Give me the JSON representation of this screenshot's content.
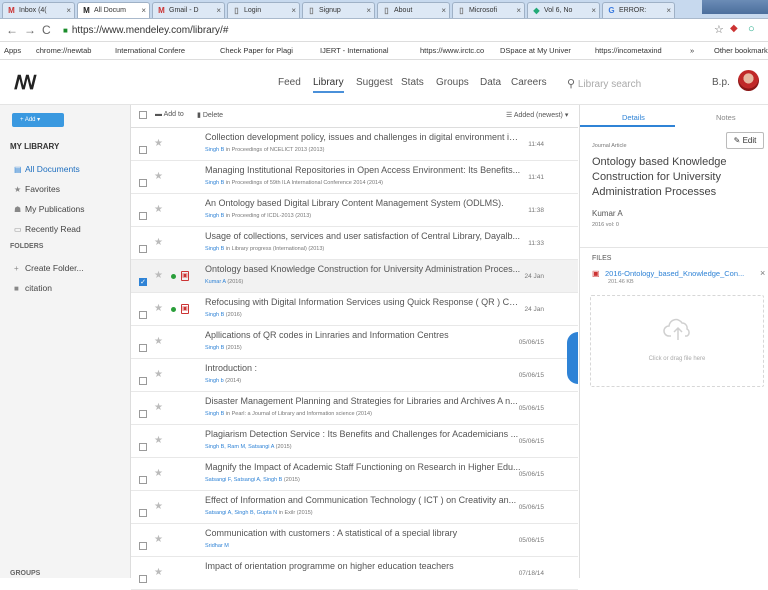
{
  "browser": {
    "tabs": [
      "Inbox (4(",
      "All Docum",
      "Gmail - D",
      "Login",
      "Signup",
      "About",
      "Microsofi",
      "Vol 6, No",
      "ERROR:"
    ],
    "url": "https://www.mendeley.com/library/#",
    "bookmarks": [
      "Apps",
      "chrome://newtab",
      "International Confere",
      "Check Paper for Plagi",
      "IJERT - International",
      "https://www.irctc.co",
      "DSpace at My Univer",
      "https://incometaxind",
      "»",
      "Other bookmarks"
    ]
  },
  "header": {
    "logo": "ꟿ",
    "nav": [
      "Feed",
      "Library",
      "Suggest",
      "Stats",
      "Groups",
      "Data",
      "Careers"
    ],
    "search_placeholder": "Library search",
    "user": "B.p."
  },
  "sidebar": {
    "add": "+ Add ▾",
    "library_title": "MY LIBRARY",
    "items": [
      "All Documents",
      "Favorites",
      "My Publications",
      "Recently Read"
    ],
    "folders_title": "FOLDERS",
    "folders": [
      "Create Folder...",
      "citation"
    ],
    "groups_title": "GROUPS"
  },
  "toolbar": {
    "add_to": "Add to",
    "delete": "Delete",
    "sort": "Added (newest) ▾"
  },
  "documents": [
    {
      "title": "Collection development policy, issues and challenges in digital environment in...",
      "authors": "Singh B",
      "source": "in Proceedings of NCELICT 2013 (2013)",
      "date": "11:44"
    },
    {
      "title": "Managing Institutional Repositories in Open Access Environment: Its Benefits...",
      "authors": "Singh B",
      "source": "in Proceedings of 59th ILA International Conference 2014 (2014)",
      "date": "11:41"
    },
    {
      "title": "An Ontology based Digital Library Content Management System (ODLMS).",
      "authors": "Singh B",
      "source": "in Proceeding of ICDL-2013 (2013)",
      "date": "11:38"
    },
    {
      "title": "Usage of collections, services and user satisfaction of Central Library, Dayalb...",
      "authors": "Singh B",
      "source": "in Library progress (International) (2013)",
      "date": "11:33"
    },
    {
      "title": "Ontology based Knowledge Construction for University Administration Proces...",
      "authors": "Kumar A",
      "source": "(2016)",
      "date": "24 Jan"
    },
    {
      "title": "Refocusing with Digital Information Services using Quick Response ( QR ) Co...",
      "authors": "Singh B",
      "source": "(2016)",
      "date": "24 Jan"
    },
    {
      "title": "Apllications of QR codes in Linraries and Information Centres",
      "authors": "Singh B",
      "source": "(2015)",
      "date": "05/06/15"
    },
    {
      "title": "Introduction :",
      "authors": "Singh b",
      "source": "(2014)",
      "date": "05/06/15"
    },
    {
      "title": "Disaster Management Planning and Strategies for Libraries and Archives A n...",
      "authors": "Singh B",
      "source": "in Pearl: a Journal of Library and Information science (2014)",
      "date": "05/06/15"
    },
    {
      "title": "Plagiarism Detection Service : Its Benefits and Challenges for Academicians ...",
      "authors": "Singh B, Ram M, Satsangi A",
      "source": "(2015)",
      "date": "05/06/15"
    },
    {
      "title": "Magnify the Impact of Academic Staff Functioning on Research in Higher Edu...",
      "authors": "Satsangi F, Satsangi A, Singh B",
      "source": "(2015)",
      "date": "05/06/15"
    },
    {
      "title": "Effect of Information and Communication Technology ( ICT ) on Creativity an...",
      "authors": "Satsangi A, Singh B, Gupta N",
      "source": "in Exilr (2015)",
      "date": "05/06/15"
    },
    {
      "title": "Communication with customers : A statistical of a special library",
      "authors": "Sridhar M",
      "source": "",
      "date": "05/06/15"
    },
    {
      "title": "Impact of orientation programme on higher education teachers",
      "authors": "",
      "source": "",
      "date": "07/18/14"
    }
  ],
  "details": {
    "tab_details": "Details",
    "tab_notes": "Notes",
    "edit": "Edit",
    "type": "Journal Article",
    "title": "Ontology based Knowledge Construction for University Administration Processes",
    "author": "Kumar A",
    "meta": "2016 vol: 0",
    "files_title": "FILES",
    "file_name": "2016-Ontology_based_Knowledge_Con...",
    "file_size": "201.46 KB",
    "drop_text": "Click or drag file here"
  }
}
